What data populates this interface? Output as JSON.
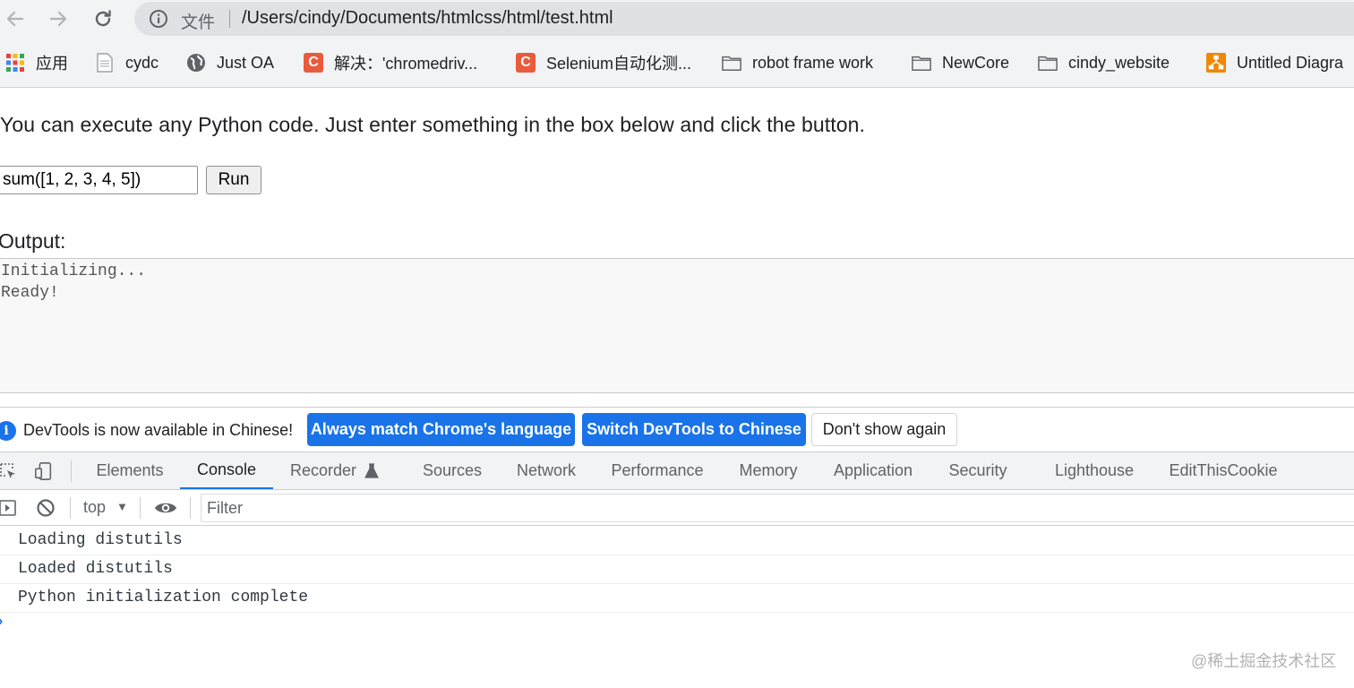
{
  "browser": {
    "omnibox": {
      "file_label": "文件",
      "url": "/Users/cindy/Documents/htmlcss/html/test.html"
    },
    "bookmarks": [
      {
        "label": "应用",
        "icon": "apps-grid-icon"
      },
      {
        "label": "cydc",
        "icon": "page-icon"
      },
      {
        "label": "Just OA",
        "icon": "globe-icon"
      },
      {
        "label": "解决：'chromedriv...",
        "icon": "c-site-icon"
      },
      {
        "label": "Selenium自动化测...",
        "icon": "c-site-icon"
      },
      {
        "label": "robot frame work",
        "icon": "folder-icon"
      },
      {
        "label": "NewCore",
        "icon": "folder-icon"
      },
      {
        "label": "cindy_website",
        "icon": "folder-icon"
      },
      {
        "label": "Untitled Diagra",
        "icon": "diagram-icon"
      }
    ],
    "c_icon_letter": "C"
  },
  "page": {
    "intro": "You can execute any Python code. Just enter something in the box below and click the button.",
    "code_value": "sum([1, 2, 3, 4, 5])",
    "run_label": "Run",
    "output_label": "Output:",
    "output_lines": [
      "Initializing...",
      "Ready!"
    ]
  },
  "devtools": {
    "info_icon_glyph": "i",
    "info_text": "DevTools is now available in Chinese!",
    "btn_match": "Always match Chrome's language",
    "btn_switch": "Switch DevTools to Chinese",
    "btn_dont_show": "Don't show again",
    "tabs": [
      "Elements",
      "Console",
      "Recorder",
      "Sources",
      "Network",
      "Performance",
      "Memory",
      "Application",
      "Security",
      "Lighthouse",
      "EditThisCookie"
    ],
    "active_tab": "Console",
    "context": "top",
    "context_arrow": "▼",
    "filter_placeholder": "Filter",
    "logs": [
      "Loading distutils",
      "Loaded distutils",
      "Python initialization complete"
    ],
    "prompt_glyph": "›"
  },
  "watermark": "@稀土掘金技术社区",
  "colors": {
    "accent": "#1a73e8",
    "c_icon": "#ea5a3c",
    "chrome_bg": "#f1f3f4"
  }
}
